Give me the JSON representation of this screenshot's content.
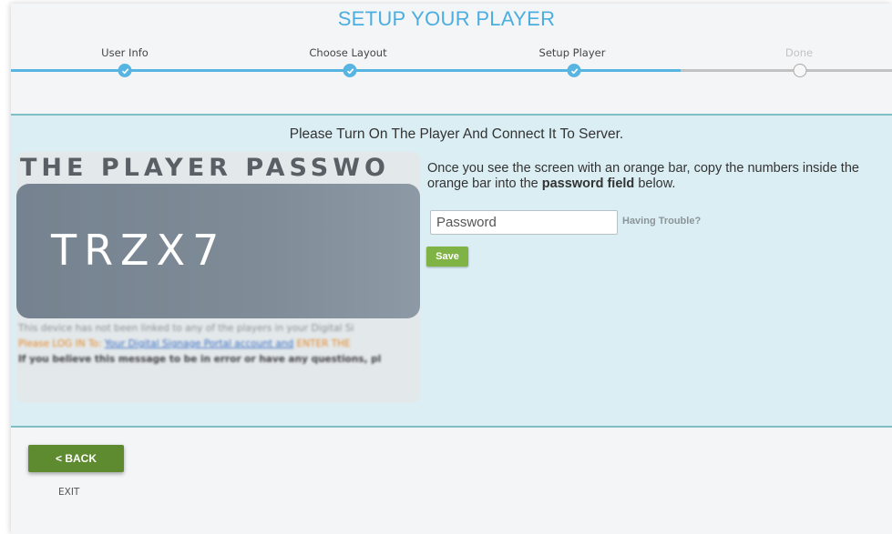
{
  "header": {
    "title": "SETUP YOUR PLAYER"
  },
  "steps": [
    {
      "label": "User Info",
      "state": "done"
    },
    {
      "label": "Choose Layout",
      "state": "done"
    },
    {
      "label": "Setup Player",
      "state": "done"
    },
    {
      "label": "Done",
      "state": "pending"
    }
  ],
  "main": {
    "heading": "Please Turn On The Player And Connect It To Server.",
    "instructions": {
      "text_before": "Once you see the screen with an orange bar, copy the numbers inside the orange bar into the ",
      "emphasis": "password field",
      "text_after": " below."
    },
    "password": {
      "placeholder": "Password",
      "value": ""
    },
    "help_link": "Having Trouble?",
    "save_label": "Save"
  },
  "preview": {
    "heading": "THE PLAYER PASSWO",
    "code": "TRZX7",
    "line1": "This device has not been linked to any of the players in your Digital Si",
    "line2_a": "Please LOG IN To: ",
    "line2_link": "Your Digital Signage Portal account and",
    "line2_b": " ENTER THE",
    "line3": "If you believe this message to be in error or have any questions, pl"
  },
  "footer": {
    "back_label": "< BACK",
    "exit_label": "EXIT"
  },
  "colors": {
    "accent": "#4aaee0",
    "panel_bg": "#daeef4",
    "save_green": "#7fb345",
    "back_green": "#5e8a30"
  }
}
